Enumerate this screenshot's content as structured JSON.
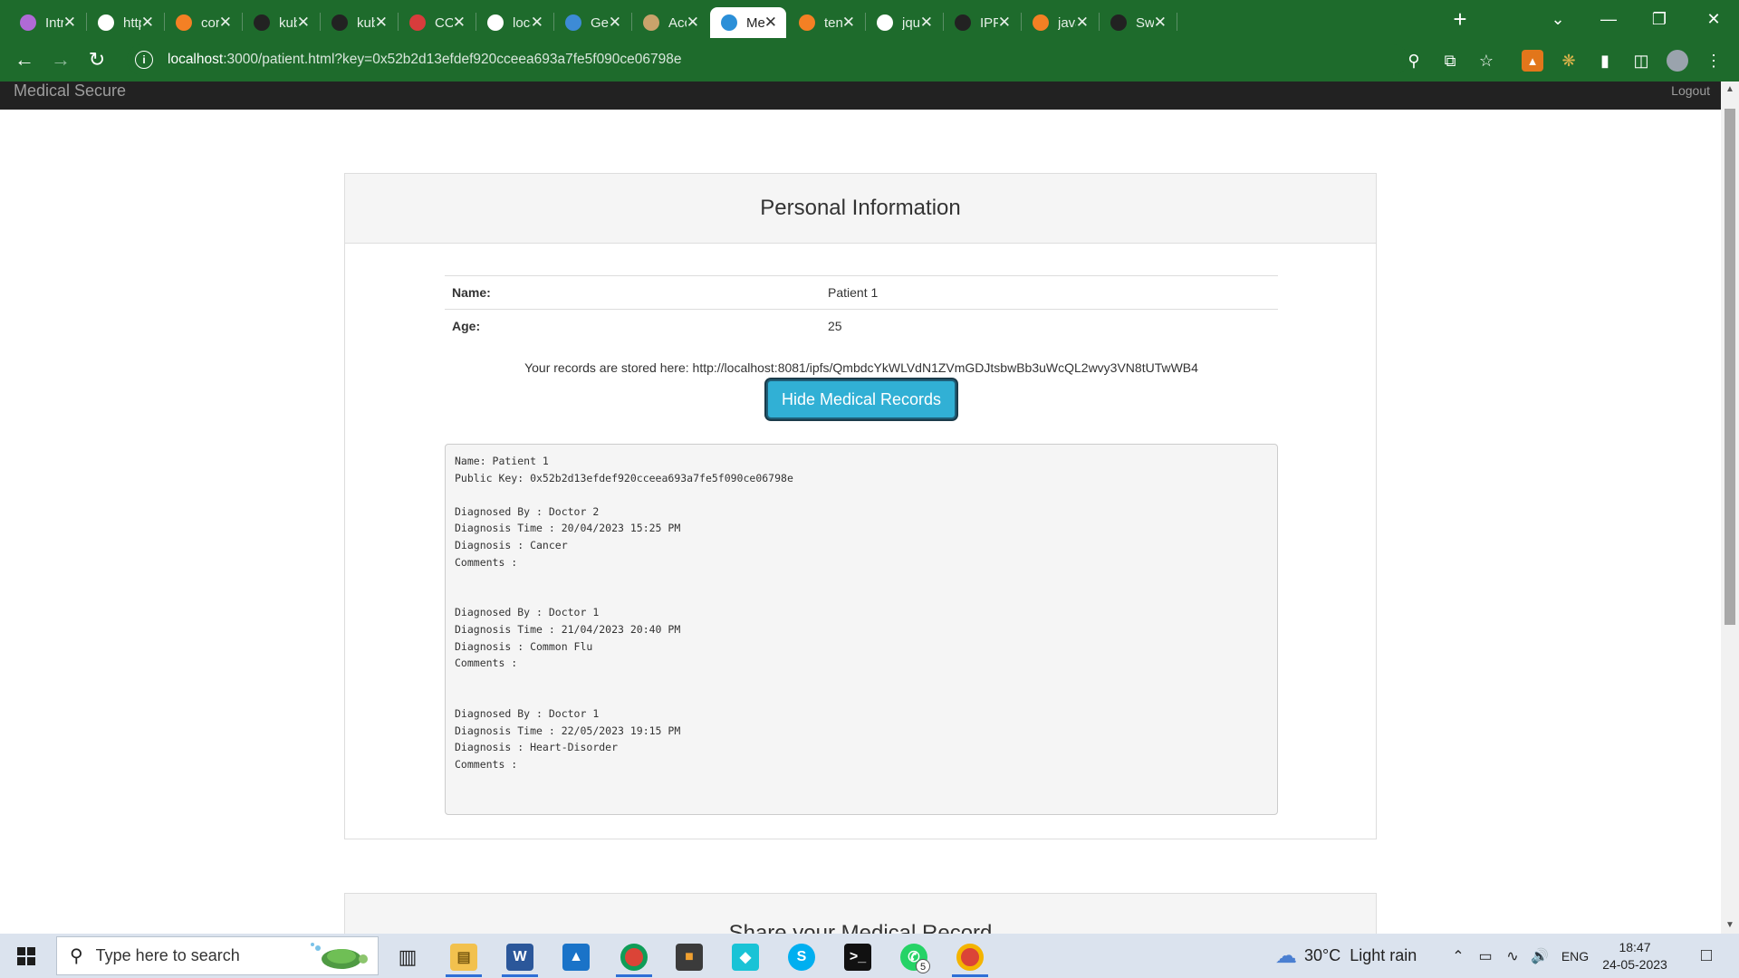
{
  "browser": {
    "tabs": [
      {
        "label": "Intr",
        "icon": "openai-icon",
        "color": "#b06ad6",
        "active": false
      },
      {
        "label": "http",
        "icon": "chatgpt-icon",
        "color": "#ffffff",
        "active": false
      },
      {
        "label": "cor",
        "icon": "stackoverflow-icon",
        "color": "#f48024",
        "active": false
      },
      {
        "label": "kub",
        "icon": "github-icon",
        "color": "#222222",
        "active": false
      },
      {
        "label": "kub",
        "icon": "github-icon",
        "color": "#222222",
        "active": false
      },
      {
        "label": "COI",
        "icon": "cors-icon",
        "color": "#d83c3c",
        "active": false
      },
      {
        "label": "loca",
        "icon": "page-icon",
        "color": "#ffffff",
        "active": false
      },
      {
        "label": "Get",
        "icon": "edit-icon",
        "color": "#3d8bd6",
        "active": false
      },
      {
        "label": "Acc",
        "icon": "truffle-icon",
        "color": "#c9a36b",
        "active": false
      },
      {
        "label": "Me",
        "icon": "medical-icon",
        "color": "#2b8fd8",
        "active": true
      },
      {
        "label": "ten",
        "icon": "stackoverflow-icon",
        "color": "#f48024",
        "active": false
      },
      {
        "label": "jqu",
        "icon": "google-icon",
        "color": "#ffffff",
        "active": false
      },
      {
        "label": "IPFS",
        "icon": "github-icon",
        "color": "#222222",
        "active": false
      },
      {
        "label": "java",
        "icon": "stackoverflow-icon",
        "color": "#f48024",
        "active": false
      },
      {
        "label": "Swa",
        "icon": "github-icon",
        "color": "#222222",
        "active": false
      }
    ],
    "url_host": "localhost",
    "url_rest": ":3000/patient.html?key=0x52b2d13efdef920cceea693a7fe5f090ce06798e"
  },
  "navbar": {
    "brand": "Medical Secure",
    "logout": "Logout"
  },
  "personal_info": {
    "heading": "Personal Information",
    "rows": [
      {
        "key": "Name:",
        "value": "Patient 1"
      },
      {
        "key": "Age:",
        "value": "25"
      }
    ],
    "records_line": "Your records are stored here: http://localhost:8081/ipfs/QmbdcYkWLVdN1ZVmGDJtsbwBb3uWcQL2wvy3VN8tUTwWB4",
    "hide_button": "Hide Medical Records",
    "records_text": "Name: Patient 1\nPublic Key: 0x52b2d13efdef920cceea693a7fe5f090ce06798e\n\nDiagnosed By : Doctor 2\nDiagnosis Time : 20/04/2023 15:25 PM\nDiagnosis : Cancer\nComments :\n\n\nDiagnosed By : Doctor 1\nDiagnosis Time : 21/04/2023 20:40 PM\nDiagnosis : Common Flu\nComments :\n\n\nDiagnosed By : Doctor 1\nDiagnosis Time : 22/05/2023 19:15 PM\nDiagnosis : Heart-Disorder\nComments :"
  },
  "share_panel": {
    "heading": "Share your Medical Record"
  },
  "taskbar": {
    "search_placeholder": "Type here to search",
    "whatsapp_badge": "5",
    "weather_temp": "30°C",
    "weather_desc": "Light rain",
    "language": "ENG",
    "time": "18:47",
    "date": "24-05-2023"
  }
}
